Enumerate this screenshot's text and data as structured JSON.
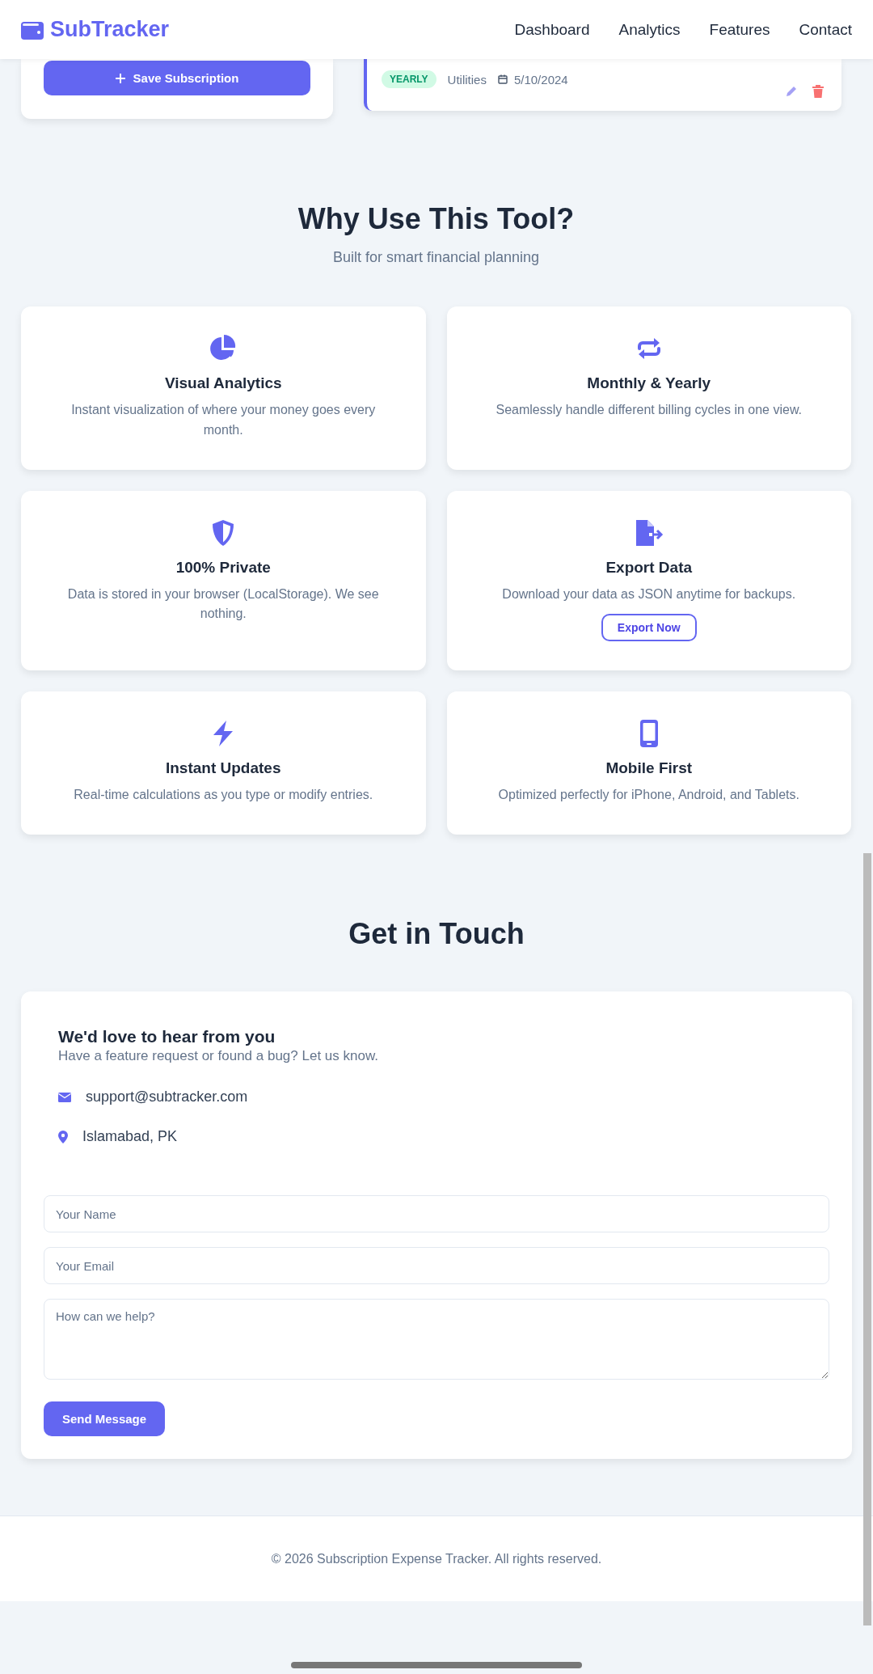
{
  "nav": {
    "brand": "SubTracker",
    "links": [
      "Dashboard",
      "Analytics",
      "Features",
      "Contact"
    ]
  },
  "form_card": {
    "save_button": "Save Subscription"
  },
  "subscription": {
    "cycle": "YEARLY",
    "category": "Utilities",
    "date": "5/10/2024"
  },
  "features": {
    "title": "Why Use This Tool?",
    "subtitle": "Built for smart financial planning",
    "items": [
      {
        "title": "Visual Analytics",
        "description": "Instant visualization of where your money goes every month."
      },
      {
        "title": "Monthly & Yearly",
        "description": "Seamlessly handle different billing cycles in one view."
      },
      {
        "title": "100% Private",
        "description": "Data is stored in your browser (LocalStorage). We see nothing."
      },
      {
        "title": "Export Data",
        "description": "Download your data as JSON anytime for backups.",
        "button": "Export Now"
      },
      {
        "title": "Instant Updates",
        "description": "Real-time calculations as you type or modify entries."
      },
      {
        "title": "Mobile First",
        "description": "Optimized perfectly for iPhone, Android, and Tablets."
      }
    ]
  },
  "contact": {
    "title": "Get in Touch",
    "heading": "We'd love to hear from you",
    "text": "Have a feature request or found a bug? Let us know.",
    "email": "support@subtracker.com",
    "location": "Islamabad, PK",
    "fields": [
      {
        "kind": "input",
        "placeholder": "Your Name"
      },
      {
        "kind": "input",
        "placeholder": "Your Email"
      },
      {
        "kind": "textarea",
        "placeholder": "How can we help?"
      }
    ],
    "button": "Send Message"
  },
  "footer": {
    "text": "© 2026 Subscription Expense Tracker. All rights reserved."
  }
}
